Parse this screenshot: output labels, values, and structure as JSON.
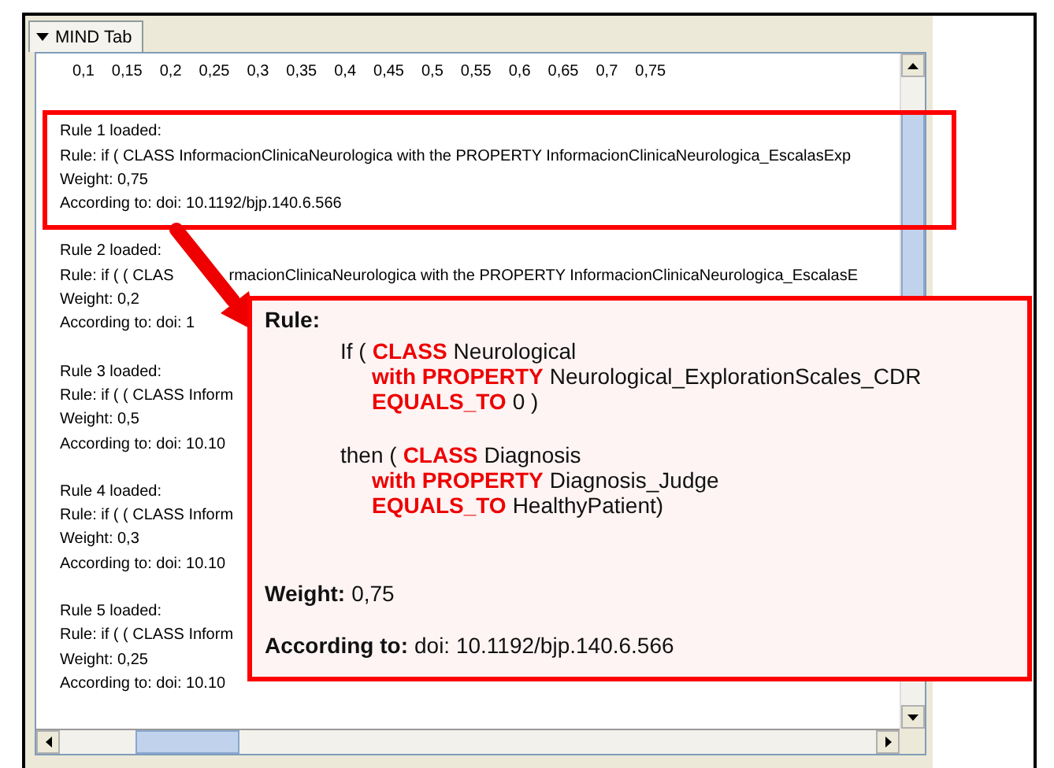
{
  "tab": {
    "label": "MIND Tab",
    "expanded": true
  },
  "scale": [
    "0,1",
    "0,15",
    "0,2",
    "0,25",
    "0,3",
    "0,35",
    "0,4",
    "0,45",
    "0,5",
    "0,55",
    "0,6",
    "0,65",
    "0,7",
    "0,75"
  ],
  "rules": [
    {
      "lines": [
        "Rule 1 loaded:",
        "Rule: if ( CLASS InformacionClinicaNeurologica with the PROPERTY InformacionClinicaNeurologica_EscalasExp",
        "Weight: 0,75",
        "According to: doi: 10.1192/bjp.140.6.566"
      ],
      "highlighted": true
    },
    {
      "lines": [
        "Rule 2 loaded:",
        [
          "Rule: if ( ( CLAS",
          "rmacionClinicaNeurologica with the PROPERTY InformacionClinicaNeurologica_EscalasE"
        ],
        "Weight: 0,2",
        "According to: doi: 1"
      ],
      "highlighted": false
    },
    {
      "lines": [
        "Rule 3 loaded:",
        "Rule: if ( ( CLASS Inform",
        "Weight: 0,5",
        "According to: doi: 10.10"
      ],
      "highlighted": false
    },
    {
      "lines": [
        "Rule 4 loaded:",
        "Rule: if ( ( CLASS Inform",
        "Weight: 0,3",
        "According to: doi: 10.10"
      ],
      "highlighted": false
    },
    {
      "lines": [
        "Rule 5 loaded:",
        "Rule: if ( ( CLASS Inform",
        "Weight: 0,25",
        "According to: doi: 10.10"
      ],
      "highlighted": false
    }
  ],
  "callout": {
    "title": "Rule:",
    "clauses": [
      {
        "head": [
          {
            "kind": "plain",
            "text": "If ("
          },
          {
            "kind": "keyword",
            "text": "CLASS"
          },
          {
            "kind": "plain",
            "text": "Neurological"
          }
        ],
        "conditions": [
          [
            {
              "kind": "keyword",
              "text": "with PROPERTY"
            },
            {
              "kind": "plain",
              "text": "Neurological_ExplorationScales_CDR"
            }
          ],
          [
            {
              "kind": "keyword",
              "text": "EQUALS_TO"
            },
            {
              "kind": "plain",
              "text": "0 )"
            }
          ]
        ]
      },
      {
        "head": [
          {
            "kind": "plain",
            "text": "then ("
          },
          {
            "kind": "keyword",
            "text": "CLASS"
          },
          {
            "kind": "plain",
            "text": "Diagnosis"
          }
        ],
        "conditions": [
          [
            {
              "kind": "keyword",
              "text": "with PROPERTY"
            },
            {
              "kind": "plain",
              "text": "Diagnosis_Judge"
            }
          ],
          [
            {
              "kind": "keyword",
              "text": "EQUALS_TO"
            },
            {
              "kind": "plain",
              "text": "HealthyPatient)"
            }
          ]
        ]
      }
    ],
    "weight_label": "Weight:",
    "weight": "0,75",
    "source_label": "According to:",
    "source": "doi:  10.1192/bjp.140.6.566"
  }
}
